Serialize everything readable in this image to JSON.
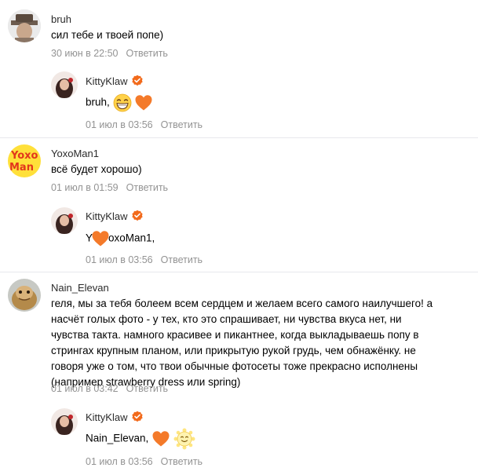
{
  "comments": [
    {
      "author": "bruh",
      "text": "сил тебе и твоей попе)",
      "date": "30 июн в 22:50",
      "reply_label": "Ответить",
      "reply": {
        "author": "KittyKlaw",
        "text": "bruh,",
        "date": "01 июл в 03:56",
        "reply_label": "Ответить"
      }
    },
    {
      "author": "YoxoMan1",
      "text": "всё будет хорошо)",
      "date": "01 июл в 01:59",
      "reply_label": "Ответить",
      "reply": {
        "author": "KittyKlaw",
        "text_prefix": "Y",
        "text_suffix": "oxoMan1,",
        "date": "01 июл в 03:56",
        "reply_label": "Ответить"
      }
    },
    {
      "author": "Nain_Elevan",
      "text_lines": [
        "геля, мы за тебя болеем всем сердцем и желаем всего самого наилучшего! а",
        "насчёт голых фото - у тех, кто это спрашивает, ни чувства вкуса нет, ни",
        "чувства такта. намного красивее и пикантнее, когда выкладываешь попу в",
        "стрингах крупным планом, или прикрытую рукой грудь, чем обнажёнку. не",
        "говоря уже о том, что твои обычные фотосеты тоже прекрасно исполнены",
        "(например strawberry dress или spring)"
      ],
      "date": "01 июл в 03:42",
      "reply_label": "Ответить",
      "reply": {
        "author": "KittyKlaw",
        "text": "Nain_Elevan,",
        "date": "01 июл в 03:56",
        "reply_label": "Ответить"
      }
    }
  ],
  "icons": {
    "verified": "verified-badge-icon",
    "heart": "orange-heart-emoji",
    "grin": "grinning-face-emoji",
    "sun": "sun-face-emoji"
  },
  "colors": {
    "verified": "#f26a1b",
    "heart": "#f47a2a",
    "meta": "#939393",
    "separator": "#e7e8ec"
  }
}
